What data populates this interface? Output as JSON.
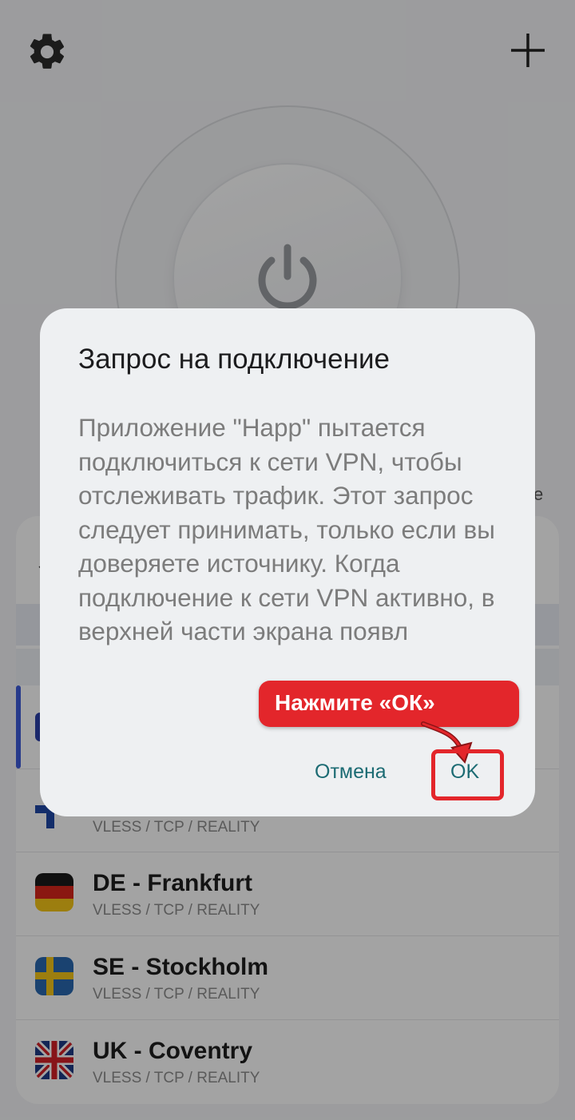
{
  "header": {
    "settings_icon": "gear-icon",
    "add_icon": "plus-icon"
  },
  "power_button": {
    "icon": "power-icon"
  },
  "servers": [
    {
      "name": "DE - Frankfurt",
      "protocol": "VLESS / TCP / REALITY",
      "flag": "germany-flag"
    },
    {
      "name": "SE - Stockholm",
      "protocol": "VLESS / TCP / REALITY",
      "flag": "sweden-flag"
    },
    {
      "name": "UK - Coventry",
      "protocol": "VLESS / TCP / REALITY",
      "flag": "uk-flag"
    }
  ],
  "partial_server": {
    "protocol": "VLESS / TCP / REALITY",
    "flag": "finland-flag"
  },
  "dialog": {
    "title": "Запрос на подключение",
    "body": "Приложение \"Happ\" пытается подключиться к сети VPN, чтобы отслеживать трафик. Этот запрос следует принимать, только если вы доверяете источнику. Когда подключение к сети VPN активно, в верхней части экрана появл",
    "cancel_label": "Отмена",
    "ok_label": "OK"
  },
  "callout": {
    "text": "Нажмите «ОК»",
    "color": "#e3262b"
  },
  "colors": {
    "accent": "#3d5bd9",
    "dialog_button": "#1c6b73",
    "highlight": "#e3262b"
  }
}
